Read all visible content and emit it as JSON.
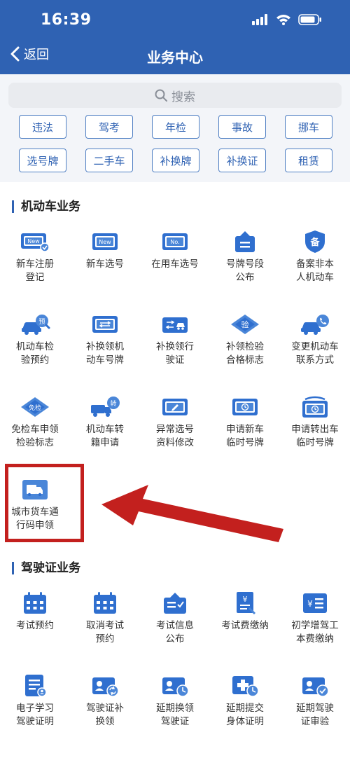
{
  "status_bar": {
    "time": "16:39"
  },
  "nav": {
    "back_label": "返回",
    "title": "业务中心"
  },
  "search": {
    "placeholder": "搜索"
  },
  "chips": [
    "违法",
    "驾考",
    "年检",
    "事故",
    "挪车",
    "选号牌",
    "二手车",
    "补换牌",
    "补换证",
    "租赁"
  ],
  "sections": [
    {
      "title": "机动车业务",
      "items": [
        {
          "label": "新车注册\n登记",
          "icon": "new-plate-check-icon"
        },
        {
          "label": "新车选号",
          "icon": "new-plate-icon"
        },
        {
          "label": "在用车选号",
          "icon": "no-plate-icon"
        },
        {
          "label": "号牌号段\n公布",
          "icon": "plate-notice-icon"
        },
        {
          "label": "备案非本\n人机动车",
          "icon": "record-shield-icon"
        },
        {
          "label": "机动车检\n验预约",
          "icon": "car-inspection-booking-icon"
        },
        {
          "label": "补换领机\n动车号牌",
          "icon": "plate-exchange-icon"
        },
        {
          "label": "补换领行\n驶证",
          "icon": "license-exchange-icon"
        },
        {
          "label": "补领检验\n合格标志",
          "icon": "inspection-mark-icon"
        },
        {
          "label": "变更机动车\n联系方式",
          "icon": "car-phone-icon"
        },
        {
          "label": "免检车申领\n检验标志",
          "icon": "exempt-mark-icon"
        },
        {
          "label": "机动车转\n籍申请",
          "icon": "car-transfer-icon"
        },
        {
          "label": "异常选号\n资料修改",
          "icon": "edit-plate-icon"
        },
        {
          "label": "申请新车\n临时号牌",
          "icon": "temp-plate-icon"
        },
        {
          "label": "申请转出车\n临时号牌",
          "icon": "temp-plate-out-icon"
        },
        {
          "label": "城市货车通\n行码申领",
          "icon": "truck-pass-icon"
        }
      ]
    },
    {
      "title": "驾驶证业务",
      "items": [
        {
          "label": "考试预约",
          "icon": "calendar-icon"
        },
        {
          "label": "取消考试\n预约",
          "icon": "calendar-cancel-icon"
        },
        {
          "label": "考试信息\n公布",
          "icon": "exam-info-icon"
        },
        {
          "label": "考试费缴纳",
          "icon": "exam-fee-icon"
        },
        {
          "label": "初学增驾工\n本费缴纳",
          "icon": "fee-list-icon"
        },
        {
          "label": "电子学习\n驾驶证明",
          "icon": "study-proof-icon"
        },
        {
          "label": "驾驶证补\n换领",
          "icon": "license-refresh-icon"
        },
        {
          "label": "延期换领\n驾驶证",
          "icon": "license-delay-icon"
        },
        {
          "label": "延期提交\n身体证明",
          "icon": "health-delay-icon"
        },
        {
          "label": "延期驾驶\n证审验",
          "icon": "license-audit-icon"
        }
      ]
    }
  ],
  "colors": {
    "brand": "#2f62b3",
    "icon_light": "#4a86d8",
    "highlight": "#c3201e"
  }
}
